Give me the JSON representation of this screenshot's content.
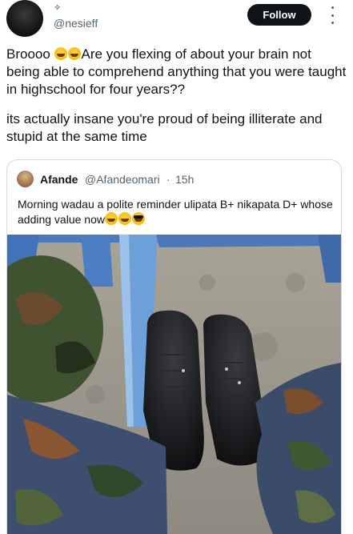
{
  "post": {
    "sparkle_icon": "sparkle-icon",
    "handle": "@nesieff",
    "follow_label": "Follow",
    "more_icon": "more-vertical-icon",
    "text_line1_a": "Broooo ",
    "text_line1_b": "Are you flexing of about your brain not being able  to comprehend anything that you were taught in highschool for four years??",
    "text_para2": "its actually insane you're proud of being illiterate and stupid at the same time"
  },
  "quote": {
    "name": "Afande",
    "handle": "@Afandeomari",
    "separator": "·",
    "time": "15h",
    "text": "Morning  wadau a polite reminder ulipata B+ nikapata D+ whose adding value now",
    "media": {
      "description_icon": "photo-boots-image"
    }
  },
  "colors": {
    "follow_bg": "#0f1419",
    "follow_text": "#ffffff",
    "secondary_text": "#536471",
    "border": "#cfd9de"
  }
}
